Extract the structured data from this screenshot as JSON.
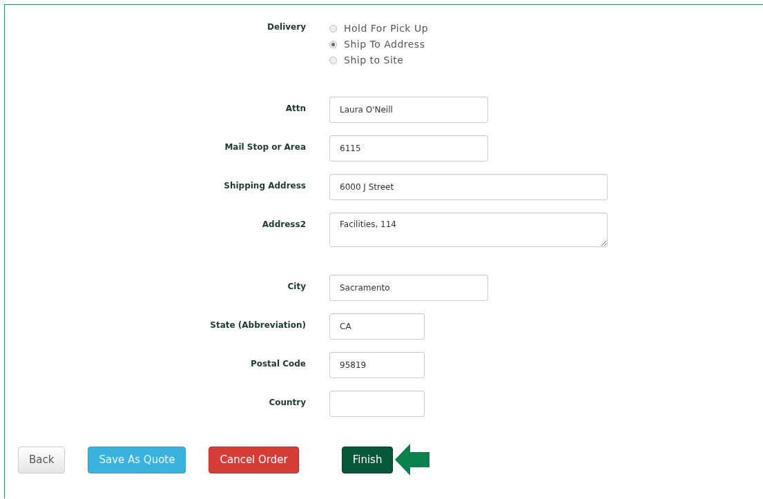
{
  "delivery": {
    "label": "Delivery",
    "options": [
      {
        "label": "Hold For Pick Up",
        "selected": false
      },
      {
        "label": "Ship To Address",
        "selected": true
      },
      {
        "label": "Ship to Site",
        "selected": false
      }
    ]
  },
  "fields": [
    {
      "label": "Attn",
      "kind": "input",
      "value": "Laura O'Neill"
    },
    {
      "label": "Mail Stop or Area",
      "kind": "input",
      "value": "6115"
    },
    {
      "label": "Shipping Address",
      "kind": "input",
      "value": "6000 J Street"
    },
    {
      "label": "Address2",
      "kind": "textarea",
      "value": "Facilities, 114"
    },
    {
      "label": "City",
      "kind": "input",
      "value": "Sacramento"
    },
    {
      "label": "State (Abbreviation)",
      "kind": "input",
      "value": "CA"
    },
    {
      "label": "Postal Code",
      "kind": "input",
      "value": "95819"
    },
    {
      "label": "Country",
      "kind": "input"
    }
  ],
  "buttons": [
    {
      "label": "Back",
      "kind": "default"
    },
    {
      "label": "Save As Quote",
      "kind": "info"
    },
    {
      "label": "Cancel Order",
      "kind": "danger"
    },
    {
      "label": "Finish",
      "kind": "success"
    }
  ]
}
